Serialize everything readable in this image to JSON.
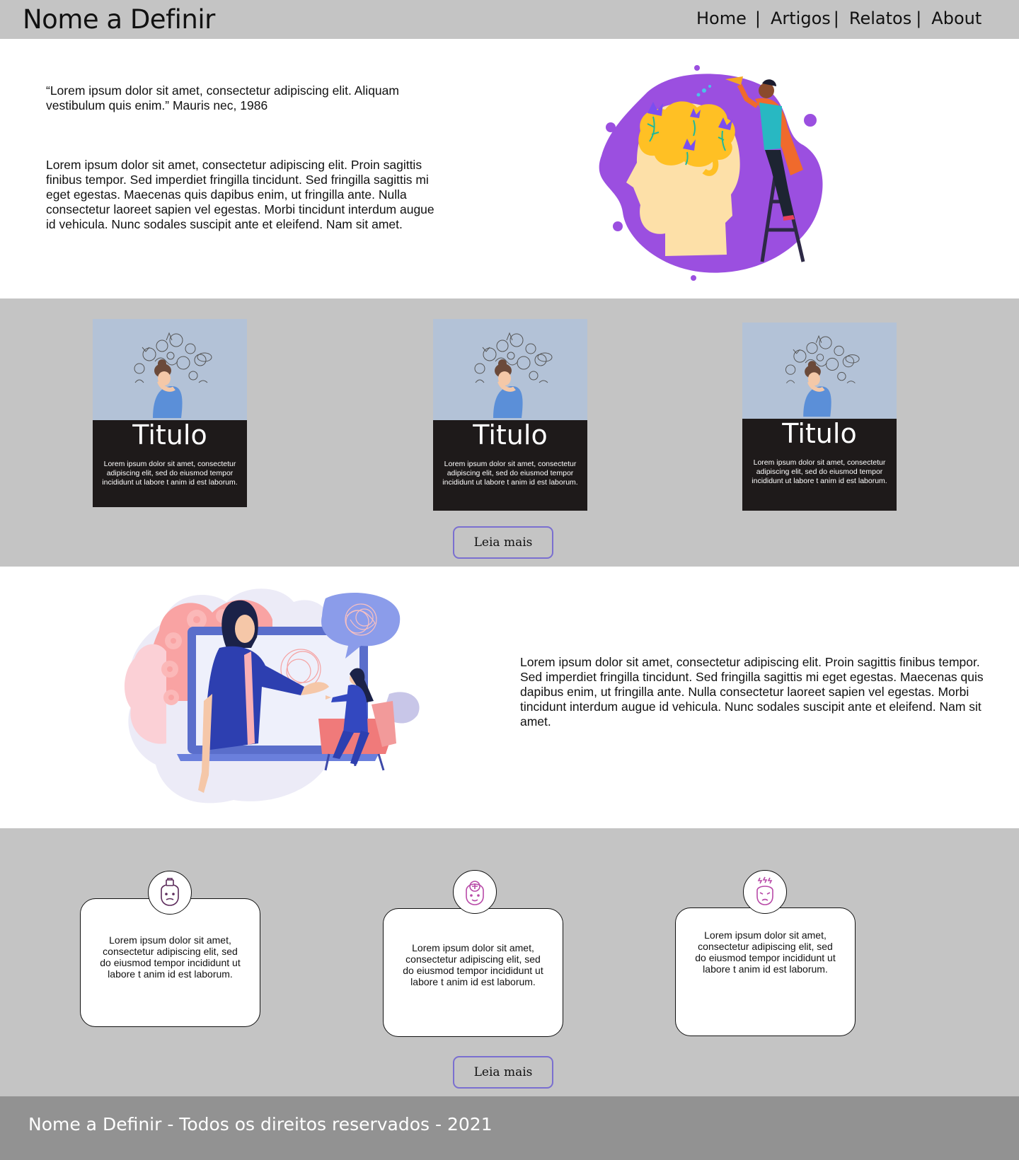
{
  "header": {
    "brand": "Nome a Definir",
    "nav": {
      "home": "Home",
      "artigos": "Artigos",
      "relatos": "Relatos",
      "about": "About",
      "separator": "|"
    }
  },
  "hero": {
    "quote": "“Lorem ipsum dolor sit amet, consectetur adipiscing elit. Aliquam vestibulum quis enim.” Mauris nec, 1986",
    "text": "Lorem ipsum dolor sit amet, consectetur adipiscing elit. Proin sagittis finibus tempor. Sed imperdiet fringilla tincidunt. Sed fringilla sagittis mi eget egestas. Maecenas quis dapibus enim, ut fringilla ante. Nulla consectetur laoreet sapien vel egestas. Morbi tincidunt interdum augue id vehicula. Nunc sodales suscipit ante et eleifend. Nam sit amet.",
    "illustration_icon": "mind-garden-illustration"
  },
  "articles": {
    "cards": [
      {
        "title": "Titulo",
        "text": "Lorem ipsum dolor sit amet, consectetur adipiscing elit, sed do eiusmod tempor incididunt ut labore t anim id est laborum."
      },
      {
        "title": "Titulo",
        "text": "Lorem ipsum dolor sit amet, consectetur adipiscing elit, sed do eiusmod tempor incididunt ut labore t anim id est laborum."
      },
      {
        "title": "Titulo",
        "text": "Lorem ipsum dolor sit amet, consectetur adipiscing elit, sed do eiusmod tempor incididunt ut labore t anim id est laborum."
      }
    ],
    "button": "Leia mais",
    "thumb_icon": "stressed-woman-illustration"
  },
  "therapy": {
    "text": "Lorem ipsum dolor sit amet, consectetur adipiscing elit. Proin sagittis finibus tempor. Sed imperdiet fringilla tincidunt. Sed fringilla sagittis mi eget egestas. Maecenas quis dapibus enim, ut fringilla ante. Nulla consectetur laoreet sapien vel egestas. Morbi tincidunt interdum augue id vehicula. Nunc sodales suscipit ante et eleifend. Nam sit amet.",
    "illustration_icon": "online-therapy-illustration"
  },
  "features": {
    "items": [
      {
        "icon": "locked-head-icon",
        "text": "Lorem ipsum dolor sit amet, consectetur adipiscing elit, sed do eiusmod tempor incididunt ut labore t anim id est laborum."
      },
      {
        "icon": "medical-head-icon",
        "text": "Lorem ipsum dolor sit amet, consectetur adipiscing elit, sed do eiusmod tempor incididunt ut labore t anim id est laborum."
      },
      {
        "icon": "stressed-head-icon",
        "text": "Lorem ipsum dolor sit amet, consectetur adipiscing elit, sed do eiusmod tempor incididunt ut labore t anim id est laborum."
      }
    ],
    "button": "Leia mais"
  },
  "footer": {
    "text": "Nome a Definir - Todos os direitos reservados - 2021"
  },
  "colors": {
    "header_bg": "#c4c4c4",
    "footer_bg": "#929292",
    "card_dark": "#1e1a1a",
    "thumb_bg": "#b3c2d7",
    "button_border": "#7a6fd0",
    "purple_blob": "#9b4fe0",
    "brain_yellow": "#ffc024"
  }
}
